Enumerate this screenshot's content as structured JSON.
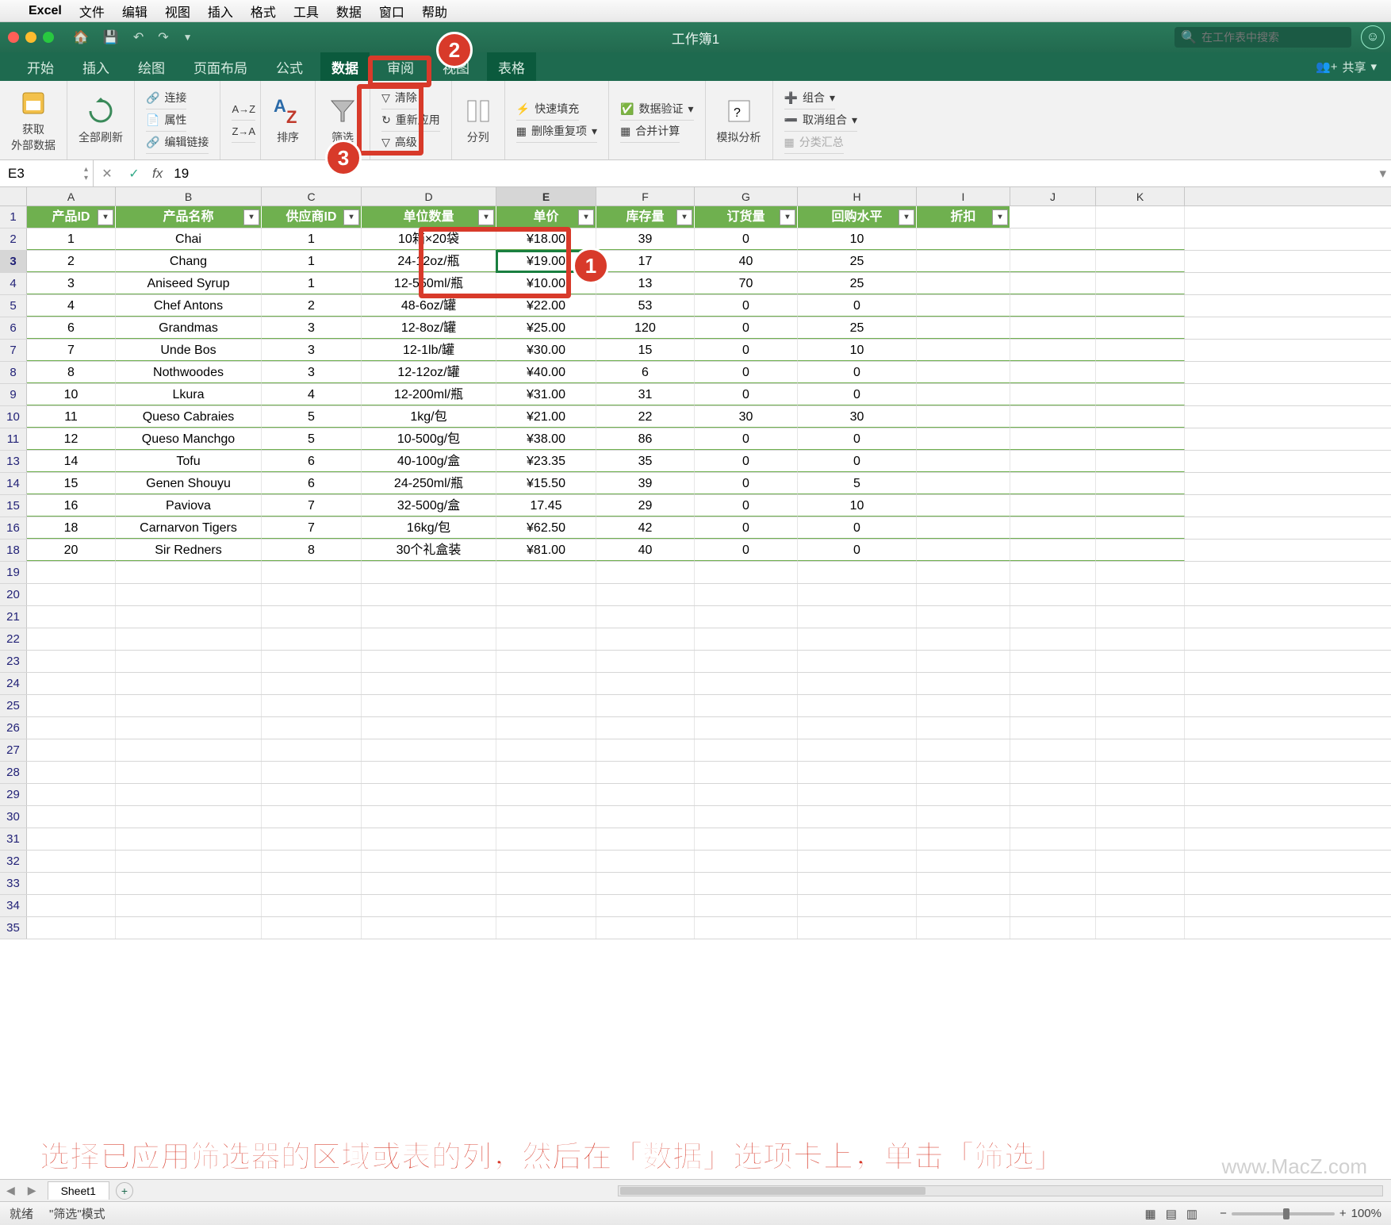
{
  "menubar": {
    "apple": "",
    "app": "Excel",
    "items": [
      "文件",
      "编辑",
      "视图",
      "插入",
      "格式",
      "工具",
      "数据",
      "窗口",
      "帮助"
    ]
  },
  "title": "工作簿1",
  "search_placeholder": "在工作表中搜索",
  "tabs": [
    "开始",
    "插入",
    "绘图",
    "页面布局",
    "公式",
    "数据",
    "审阅",
    "视图",
    "表格"
  ],
  "active_tab": 5,
  "share": "共享",
  "ribbon": {
    "get_data": "获取\n外部数据",
    "refresh": "全部刷新",
    "conn": "连接",
    "prop": "属性",
    "edit_link": "编辑链接",
    "az": "A↓Z",
    "za": "Z↓A",
    "sort": "排序",
    "filter": "筛选",
    "clear": "清除",
    "reapply": "重新应用",
    "advanced": "高级",
    "split": "分列",
    "flash": "快速填充",
    "dedup": "删除重复项",
    "validate": "数据验证",
    "consol": "合并计算",
    "whatif": "模拟分析",
    "group": "组合",
    "ungroup": "取消组合",
    "subtotal": "分类汇总"
  },
  "formula": {
    "cell": "E3",
    "value": "19"
  },
  "columns": [
    "A",
    "B",
    "C",
    "D",
    "E",
    "F",
    "G",
    "H",
    "I",
    "J",
    "K"
  ],
  "selected_col": 4,
  "headers": [
    "产品ID",
    "产品名称",
    "供应商ID",
    "单位数量",
    "单价",
    "库存量",
    "订货量",
    "回购水平",
    "折扣"
  ],
  "rows": [
    {
      "n": "1",
      "hdr": true
    },
    {
      "n": "2",
      "d": [
        "1",
        "Chai",
        "1",
        "10箱×20袋",
        "¥18.00",
        "39",
        "0",
        "10",
        ""
      ]
    },
    {
      "n": "3",
      "d": [
        "2",
        "Chang",
        "1",
        "24-12oz/瓶",
        "¥19.00",
        "17",
        "40",
        "25",
        ""
      ],
      "sel": true
    },
    {
      "n": "4",
      "d": [
        "3",
        "Aniseed Syrup",
        "1",
        "12-550ml/瓶",
        "¥10.00",
        "13",
        "70",
        "25",
        ""
      ]
    },
    {
      "n": "5",
      "d": [
        "4",
        "Chef Antons",
        "2",
        "48-6oz/罐",
        "¥22.00",
        "53",
        "0",
        "0",
        ""
      ]
    },
    {
      "n": "6",
      "d": [
        "6",
        "Grandmas",
        "3",
        "12-8oz/罐",
        "¥25.00",
        "120",
        "0",
        "25",
        ""
      ]
    },
    {
      "n": "7",
      "d": [
        "7",
        "Unde Bos",
        "3",
        "12-1lb/罐",
        "¥30.00",
        "15",
        "0",
        "10",
        ""
      ]
    },
    {
      "n": "8",
      "d": [
        "8",
        "Nothwoodes",
        "3",
        "12-12oz/罐",
        "¥40.00",
        "6",
        "0",
        "0",
        ""
      ]
    },
    {
      "n": "9",
      "d": [
        "10",
        "Lkura",
        "4",
        "12-200ml/瓶",
        "¥31.00",
        "31",
        "0",
        "0",
        ""
      ]
    },
    {
      "n": "10",
      "d": [
        "11",
        "Queso Cabraies",
        "5",
        "1kg/包",
        "¥21.00",
        "22",
        "30",
        "30",
        ""
      ]
    },
    {
      "n": "11",
      "d": [
        "12",
        "Queso Manchgo",
        "5",
        "10-500g/包",
        "¥38.00",
        "86",
        "0",
        "0",
        ""
      ]
    },
    {
      "n": "13",
      "d": [
        "14",
        "Tofu",
        "6",
        "40-100g/盒",
        "¥23.35",
        "35",
        "0",
        "0",
        ""
      ]
    },
    {
      "n": "14",
      "d": [
        "15",
        "Genen Shouyu",
        "6",
        "24-250ml/瓶",
        "¥15.50",
        "39",
        "0",
        "5",
        ""
      ]
    },
    {
      "n": "15",
      "d": [
        "16",
        "Paviova",
        "7",
        "32-500g/盒",
        "17.45",
        "29",
        "0",
        "10",
        ""
      ]
    },
    {
      "n": "16",
      "d": [
        "18",
        "Carnarvon Tigers",
        "7",
        "16kg/包",
        "¥62.50",
        "42",
        "0",
        "0",
        ""
      ]
    },
    {
      "n": "18",
      "d": [
        "20",
        "Sir Redners",
        "8",
        "30个礼盒装",
        "¥81.00",
        "40",
        "0",
        "0",
        ""
      ]
    }
  ],
  "empty_rows": [
    "19",
    "20",
    "21",
    "22",
    "23",
    "24",
    "25",
    "26",
    "27",
    "28",
    "29",
    "30",
    "31",
    "32",
    "33",
    "34",
    "35"
  ],
  "sheet": "Sheet1",
  "status": {
    "ready": "就绪",
    "mode": "\"筛选\"模式",
    "zoom": "100%"
  },
  "annotations": {
    "n1": "1",
    "n2": "2",
    "n3": "3"
  },
  "caption": "选择已应用筛选器的区域或表的列，然后在「数据」选项卡上，单击「筛选」",
  "watermark": "www.MacZ.com"
}
